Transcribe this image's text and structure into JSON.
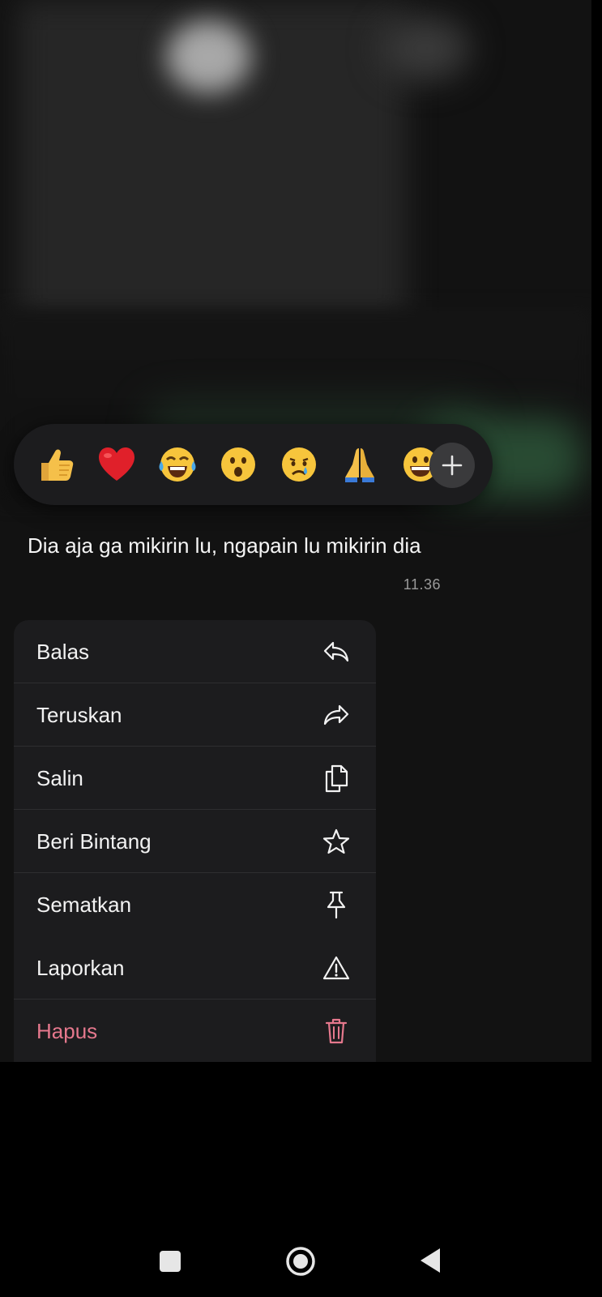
{
  "reactions": [
    {
      "name": "thumbs-up",
      "char": "👍"
    },
    {
      "name": "red-heart",
      "char": "❤"
    },
    {
      "name": "tears-of-joy",
      "char": "😂"
    },
    {
      "name": "open-mouth",
      "char": "😮"
    },
    {
      "name": "crying",
      "char": "😢"
    },
    {
      "name": "folded-hands",
      "char": "🙏"
    },
    {
      "name": "grinning",
      "char": "😀"
    }
  ],
  "add_reaction_icon": "plus-icon",
  "message": {
    "text": "Dia aja ga mikirin lu, ngapain lu mikirin dia",
    "time": "11.36"
  },
  "menu": {
    "reply_label": "Balas",
    "forward_label": "Teruskan",
    "copy_label": "Salin",
    "star_label": "Beri Bintang",
    "pin_label": "Sematkan",
    "report_label": "Laporkan",
    "delete_label": "Hapus"
  },
  "colors": {
    "danger": "#e5788d",
    "menu_background": "#1c1c1e",
    "screen_background": "#121212"
  },
  "nav": {
    "icons": [
      "recents-square-icon",
      "home-circle-icon",
      "back-triangle-icon"
    ]
  }
}
